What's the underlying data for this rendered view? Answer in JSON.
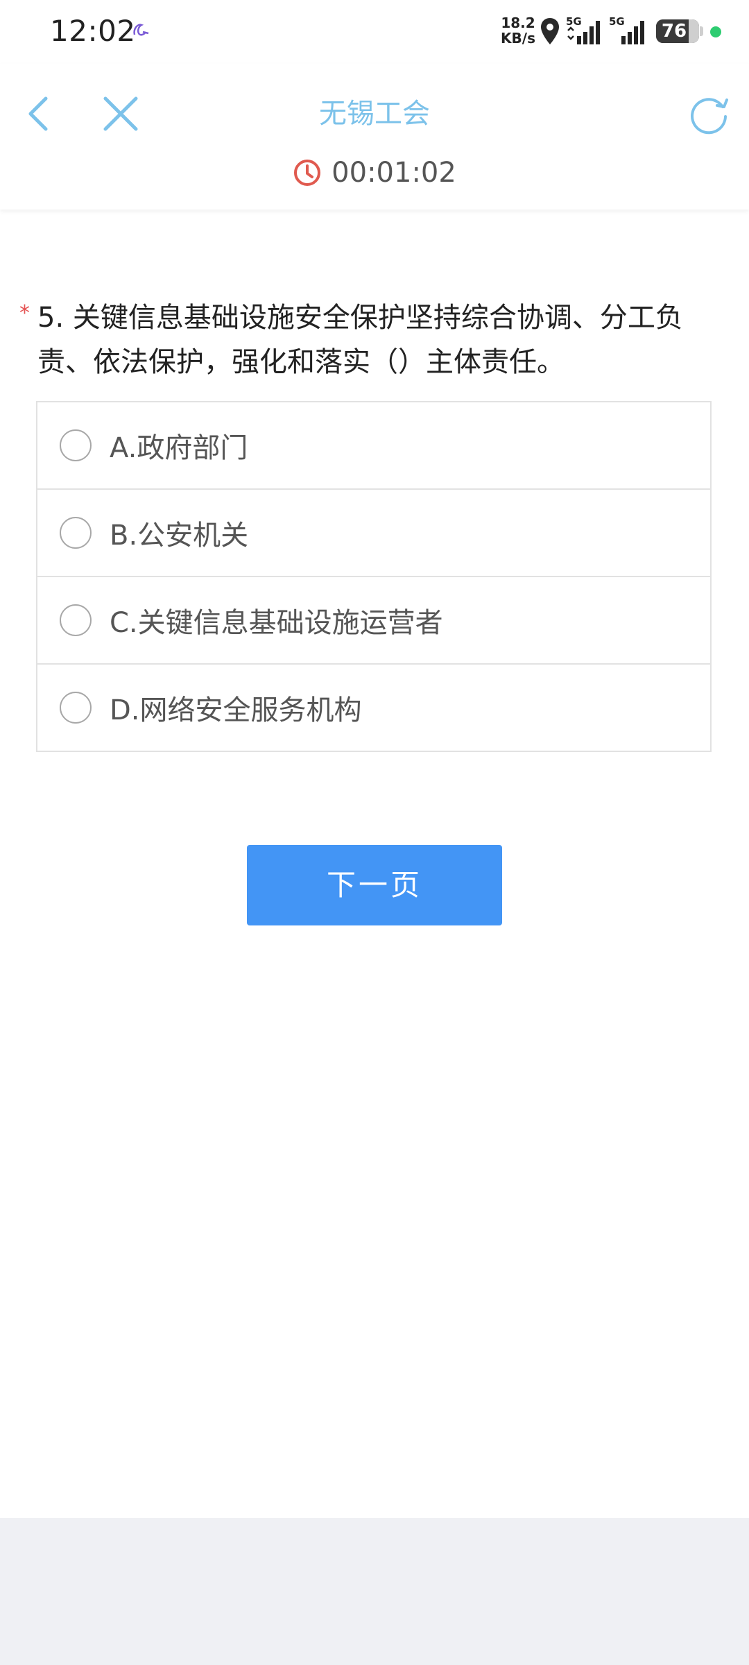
{
  "status_bar": {
    "time": "12:02",
    "net_speed_value": "18.2",
    "net_speed_unit": "KB/s",
    "signal1_label": "5G",
    "signal2_label": "5G",
    "battery_level": "76",
    "battery_fraction": 0.76
  },
  "header": {
    "title": "无锡工会",
    "timer": "00:01:02"
  },
  "question": {
    "required_mark": "*",
    "text": "5. 关键信息基础设施安全保护坚持综合协调、分工负责、依法保护，强化和落实（）主体责任。",
    "options": [
      {
        "label": "A.政府部门",
        "selected": false
      },
      {
        "label": "B.公安机关",
        "selected": false
      },
      {
        "label": "C.关键信息基础设施运营者",
        "selected": false
      },
      {
        "label": "D.网络安全服务机构",
        "selected": false
      }
    ]
  },
  "next_button_label": "下一页",
  "colors": {
    "accent": "#4395f5",
    "title": "#7cc2ea",
    "clock": "#e05a4f",
    "required": "#e55353"
  }
}
